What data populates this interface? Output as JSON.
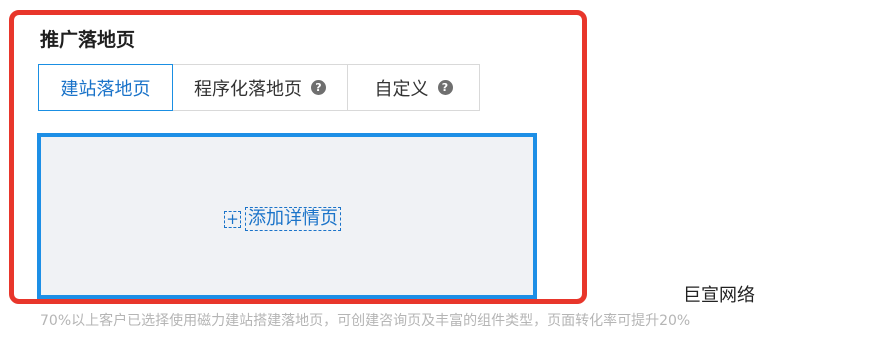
{
  "section": {
    "title": "推广落地页"
  },
  "tabs": [
    {
      "label": "建站落地页",
      "active": true
    },
    {
      "label": "程序化落地页",
      "help_icon": "question-circle-icon"
    },
    {
      "label": "自定义",
      "help_icon": "question-circle-icon"
    }
  ],
  "detail": {
    "add_icon": "plus-icon",
    "add_label": "添加详情页"
  },
  "watermark": "巨宣网络",
  "footer_note": "70%以上客户已选择使用磁力建站搭建落地页，可创建咨询页及丰富的组件类型，页面转化率可提升20%",
  "colors": {
    "highlight": "#e8362b",
    "accent": "#1a8fe3"
  }
}
